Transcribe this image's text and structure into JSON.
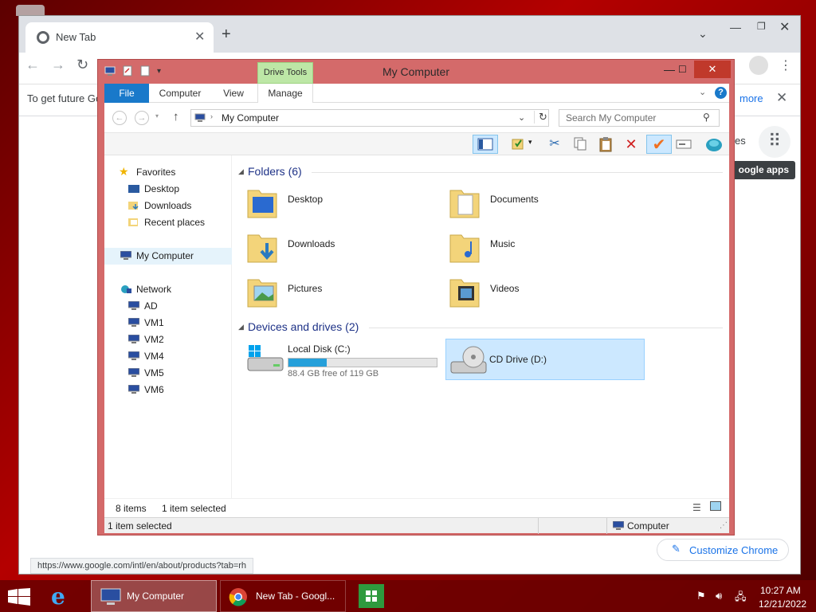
{
  "colors": {
    "explorer_frame": "#d46a6a",
    "taskbar": "#6e0000",
    "ribbon_file_tab": "#1979ca",
    "selection": "#cce8ff",
    "drive_bar": "#26a0da",
    "drive_tools_tab": "#bde7a6"
  },
  "chrome": {
    "tab_title": "New Tab",
    "infobar_text": "To get future Go",
    "infobar_more": "more",
    "images_link_fragment": "es",
    "apps_tooltip": "oogle apps",
    "customize_label": "Customize Chrome",
    "status_url": "https://www.google.com/intl/en/about/products?tab=rh"
  },
  "explorer": {
    "title": "My Computer",
    "contextual_tab_group": "Drive Tools",
    "ribbon_tabs": [
      "File",
      "Computer",
      "View",
      "Manage"
    ],
    "address": "My Computer",
    "search_placeholder": "Search My Computer",
    "nav": {
      "favorites": "Favorites",
      "favorites_items": [
        "Desktop",
        "Downloads",
        "Recent places"
      ],
      "computer": "My Computer",
      "network": "Network",
      "network_items": [
        "AD",
        "VM1",
        "VM2",
        "VM4",
        "VM5",
        "VM6"
      ]
    },
    "folders_header": "Folders (6)",
    "folders": [
      "Desktop",
      "Documents",
      "Downloads",
      "Music",
      "Pictures",
      "Videos"
    ],
    "drives_header": "Devices and drives (2)",
    "drives": [
      {
        "label": "Local Disk (C:)",
        "free_text": "88.4 GB free of 119 GB",
        "used_fraction": 0.257
      },
      {
        "label": "CD Drive (D:)"
      }
    ],
    "status_items": "8 items",
    "status_selected": "1 item selected",
    "details_selected": "1 item selected",
    "details_location": "Computer"
  },
  "taskbar": {
    "items": [
      "My Computer",
      "New Tab - Googl..."
    ],
    "time": "10:27 AM",
    "date": "12/21/2022"
  }
}
